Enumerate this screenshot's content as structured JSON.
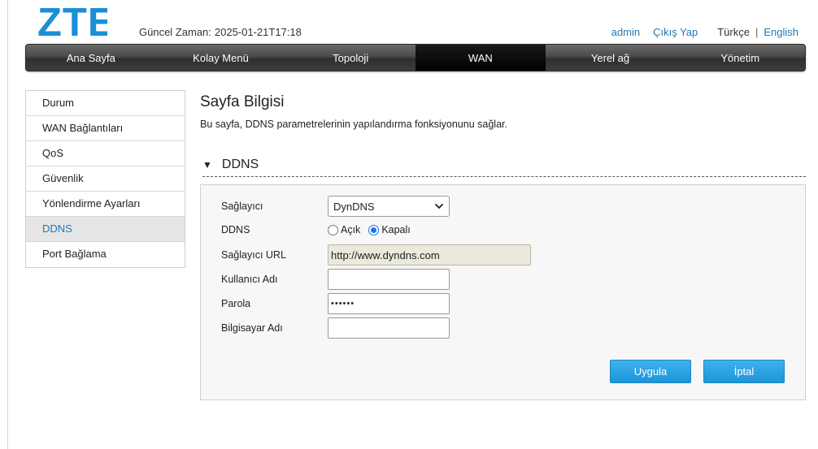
{
  "header": {
    "logo_text": "ZTE",
    "time_label": "Güncel Zaman:",
    "time_value": "2025-01-21T17:18",
    "user": "admin",
    "logout": "Çıkış Yap",
    "lang_current": "Türkçe",
    "lang_separator": "|",
    "lang_other": "English"
  },
  "nav": {
    "items": [
      {
        "label": "Ana Sayfa"
      },
      {
        "label": "Kolay Menü"
      },
      {
        "label": "Topoloji"
      },
      {
        "label": "WAN"
      },
      {
        "label": "Yerel ağ"
      },
      {
        "label": "Yönetim"
      }
    ],
    "active": "WAN"
  },
  "sidebar": {
    "items": [
      {
        "label": "Durum"
      },
      {
        "label": "WAN Bağlantıları"
      },
      {
        "label": "QoS"
      },
      {
        "label": "Güvenlik"
      },
      {
        "label": "Yönlendirme Ayarları"
      },
      {
        "label": "DDNS"
      },
      {
        "label": "Port Bağlama"
      }
    ],
    "active": "DDNS"
  },
  "page": {
    "title": "Sayfa Bilgisi",
    "description": "Bu sayfa, DDNS parametrelerinin yapılandırma fonksiyonunu sağlar."
  },
  "section": {
    "title": "DDNS"
  },
  "form": {
    "provider_label": "Sağlayıcı",
    "provider_value": "DynDNS",
    "ddns_label": "DDNS",
    "ddns_on_label": "Açık",
    "ddns_off_label": "Kapalı",
    "ddns_selected": "Kapalı",
    "url_label": "Sağlayıcı URL",
    "url_value": "http://www.dyndns.com",
    "username_label": "Kullanıcı Adı",
    "username_value": "",
    "password_label": "Parola",
    "password_value": "••••••",
    "hostname_label": "Bilgisayar Adı",
    "hostname_value": ""
  },
  "buttons": {
    "apply": "Uygula",
    "cancel": "İptal"
  },
  "colors": {
    "accent_blue": "#1f78b4",
    "button_blue": "#2aa3e3",
    "logo_blue": "#1a8fd6"
  }
}
